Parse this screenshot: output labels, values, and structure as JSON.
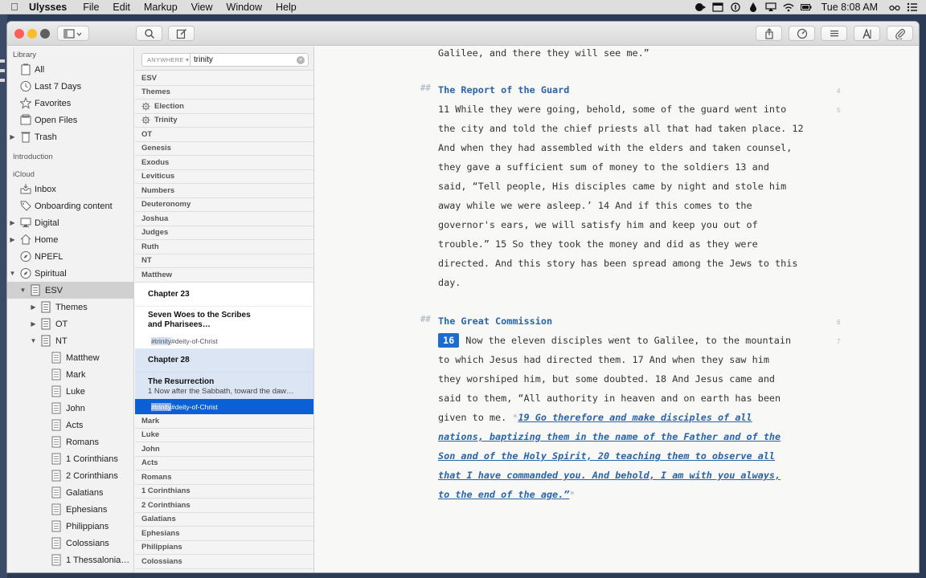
{
  "menubar": {
    "app": "Ulysses",
    "menus": [
      "File",
      "Edit",
      "Markup",
      "View",
      "Window",
      "Help"
    ],
    "clock": "Tue 8:08 AM"
  },
  "sidebar": {
    "sections": {
      "library": "Library",
      "introduction": "Introduction",
      "icloud": "iCloud"
    },
    "library_items": [
      "All",
      "Last 7 Days",
      "Favorites",
      "Open Files",
      "Trash"
    ],
    "icloud_items": [
      "Inbox",
      "Onboarding content",
      "Digital",
      "Home",
      "NPEFL",
      "Spiritual"
    ],
    "esv": {
      "label": "ESV",
      "children": [
        "Themes",
        "OT",
        "NT"
      ]
    },
    "nt_books": [
      "Matthew",
      "Mark",
      "Luke",
      "John",
      "Acts",
      "Romans",
      "1 Corinthians",
      "2 Corinthians",
      "Galatians",
      "Ephesians",
      "Philippians",
      "Colossians",
      "1 Thessalonia…"
    ]
  },
  "search": {
    "scope": "ANYWHERE",
    "query": "trinity"
  },
  "sheetlist": {
    "groups_top": [
      "ESV",
      "Themes",
      "Election",
      "Trinity",
      "OT",
      "Genesis",
      "Exodus",
      "Leviticus",
      "Numbers",
      "Deuteronomy",
      "Joshua",
      "Judges",
      "Ruth",
      "NT",
      "Matthew"
    ],
    "sheets": [
      {
        "title": "Chapter 23"
      },
      {
        "title_line1": "Seven Woes to the Scribes",
        "title_line2": "and Pharisees…",
        "tag_hl": "#trinity",
        "tag_rest": " #deity-of-Christ"
      },
      {
        "title": "Chapter 28"
      },
      {
        "title": "The Resurrection",
        "preview": "1 Now after the Sabbath, toward the daw…",
        "tag_hl": "#trinity",
        "tag_rest": " #deity-of-Christ"
      }
    ],
    "groups_bottom": [
      "Mark",
      "Luke",
      "John",
      "Acts",
      "Romans",
      "1 Corinthians",
      "2 Corinthians",
      "Galatians",
      "Ephesians",
      "Philippians",
      "Colossians"
    ]
  },
  "editor": {
    "top_line": "Galilee, and there they will see me.”",
    "heading_mark": "##",
    "heading1": "The Report of the Guard",
    "para1": [
      "11 While they were going, behold, some of the guard went into",
      "the city and told the chief priests all that had taken place. 12",
      "And when they had assembled with the elders and taken counsel,",
      "they gave a sufficient sum of money to the soldiers 13 and",
      "said, “Tell people, His disciples came by night and stole him",
      "away while we were asleep.’ 14 And if this comes to the",
      "governor's ears, we will satisfy him and keep you out of",
      "trouble.” 15 So they took the money and did as they were",
      "directed. And this story has been spread among the Jews to this",
      "day."
    ],
    "heading2": "The Great Commission",
    "verse_badge": "16",
    "para2_first": "Now the eleven disciples went to Galilee, to the mountain",
    "para2": [
      "to which Jesus had directed them. 17 And when they saw him",
      "they worshiped him, but some doubted. 18 And Jesus came and",
      "said to them, “All authority in heaven and on earth has been"
    ],
    "para2_line_pre": "given to me. ",
    "star": "*",
    "em_first": "19 Go therefore and make disciples of all",
    "em_lines": [
      "nations, baptizing them in the name of the Father and of the",
      "Son and of the Holy Spirit, 20 teaching them to observe all",
      "that I have commanded you. And behold, I am with you always,"
    ],
    "em_last": "to the end of the age.”",
    "para_numbers": [
      "4",
      "5",
      "6",
      "7"
    ]
  }
}
